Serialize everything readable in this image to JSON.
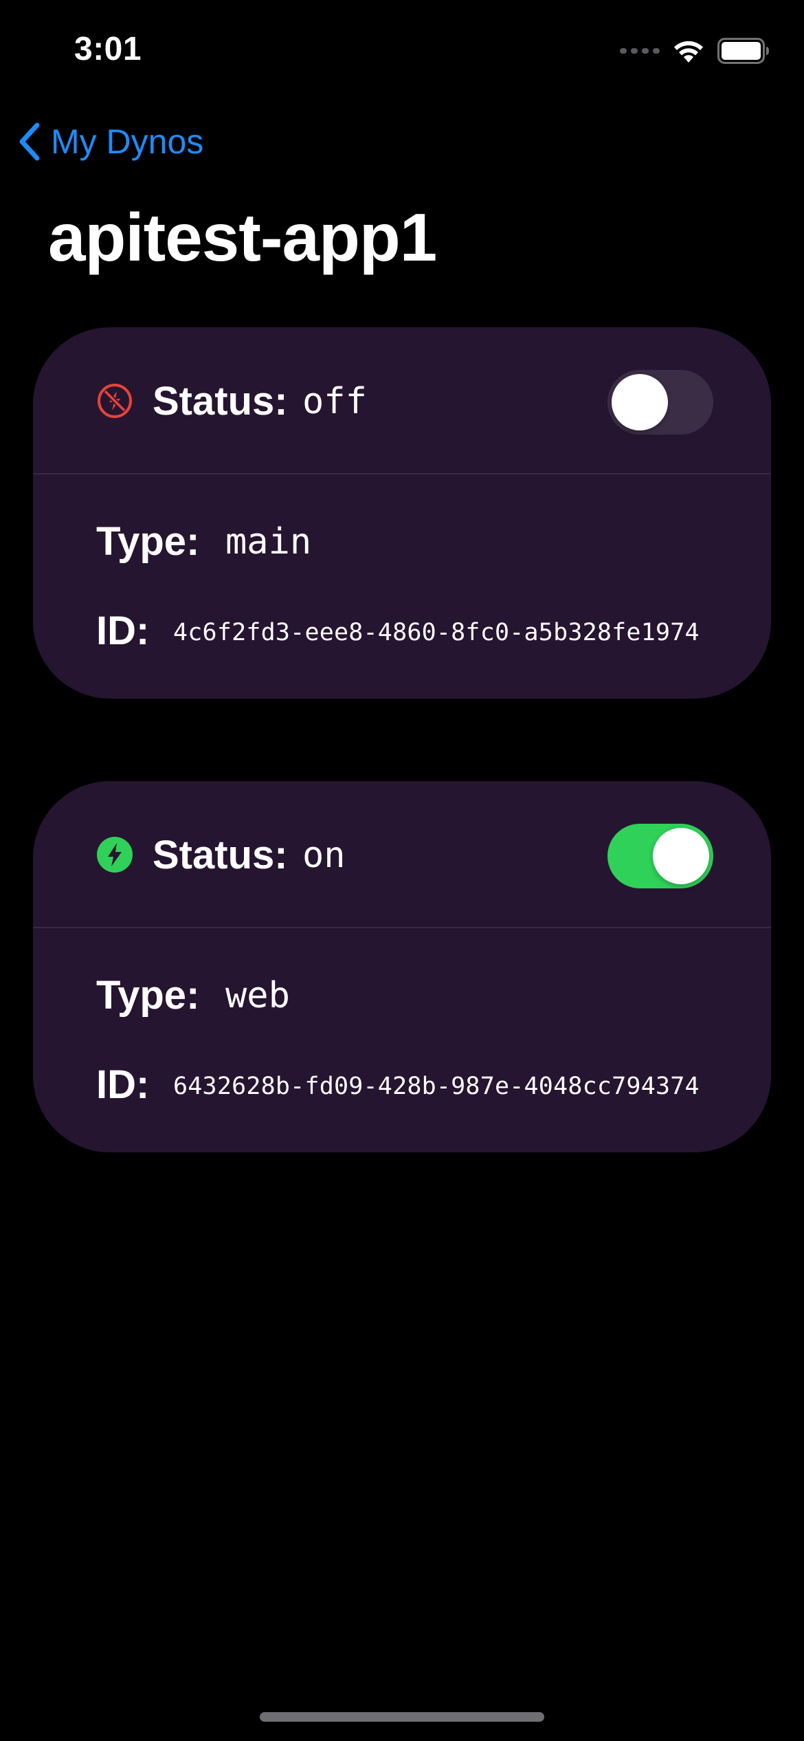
{
  "status_bar": {
    "time": "3:01",
    "signal_icon": "cellular-signal-icon",
    "wifi_icon": "wifi-icon",
    "battery_icon": "battery-icon"
  },
  "nav": {
    "back_label": "My Dynos",
    "back_icon": "chevron-left-icon",
    "title": "apitest-app1"
  },
  "dynos": [
    {
      "status_label": "Status:",
      "status_value": "off",
      "status_icon": "bolt-slash-icon",
      "status_color": "#e5443b",
      "toggle_on": false,
      "type_label": "Type:",
      "type_value": "main",
      "id_label": "ID:",
      "id_value": "4c6f2fd3-eee8-4860-8fc0-a5b328fe1974"
    },
    {
      "status_label": "Status:",
      "status_value": "on",
      "status_icon": "bolt-icon",
      "status_color": "#30d158",
      "toggle_on": true,
      "type_label": "Type:",
      "type_value": "web",
      "id_label": "ID:",
      "id_value": "6432628b-fd09-428b-987e-4048cc794374"
    }
  ],
  "colors": {
    "background": "#000000",
    "card": "#261530",
    "accent": "#1d8cf8",
    "toggle_on": "#30d158",
    "toggle_off": "#3b2d45"
  }
}
